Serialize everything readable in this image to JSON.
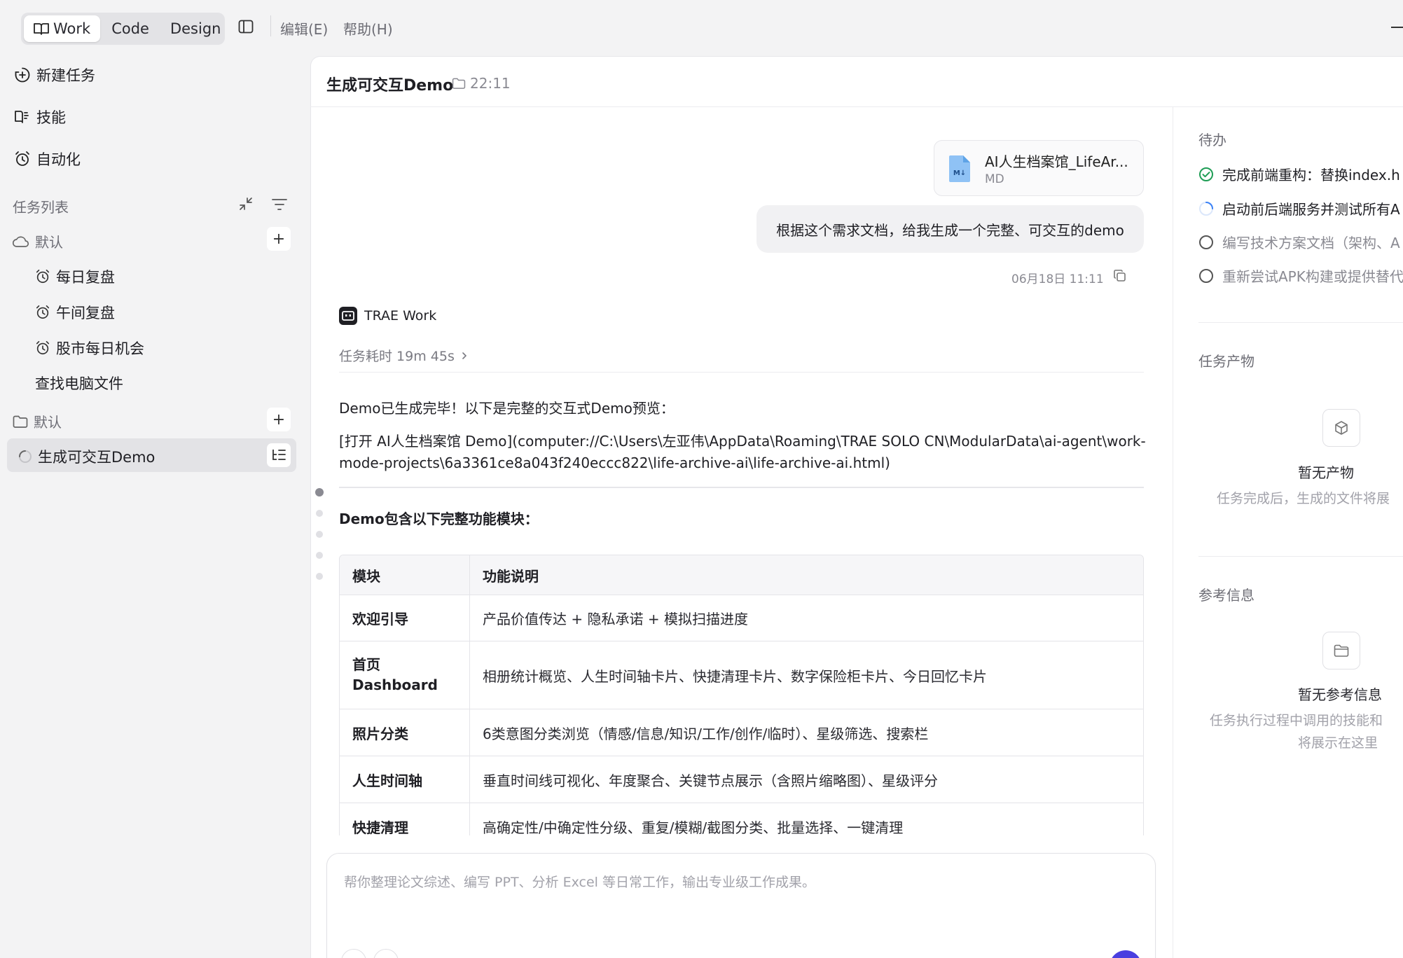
{
  "topbar": {
    "modes": [
      "Work",
      "Code",
      "Design"
    ],
    "active_mode": "Work",
    "menu": [
      "编辑(E)",
      "帮助(H)"
    ]
  },
  "sidebar": {
    "new_task": "新建任务",
    "skills": "技能",
    "automation": "自动化",
    "task_list_title": "任务列表",
    "group1": {
      "name": "默认",
      "items": [
        "每日复盘",
        "午间复盘",
        "股市每日机会",
        "查找电脑文件"
      ]
    },
    "group2": {
      "name": "默认",
      "items": [
        "生成可交互Demo"
      ]
    }
  },
  "header": {
    "title": "生成可交互Demo",
    "time": "22:11"
  },
  "chat": {
    "attachment": {
      "name": "AI人生档案馆_LifeAr...",
      "type": "MD"
    },
    "user_message": "根据这个需求文档，给我生成一个完整、可交互的demo",
    "timestamp": "06月18日 11:11",
    "agent_name": "TRAE Work",
    "duration": "任务耗时 19m 45s",
    "reply_intro": "Demo已生成完毕！以下是完整的交互式Demo预览：",
    "reply_link_line1": "[打开 AI人生档案馆 Demo](computer://C:\\Users\\左亚伟\\AppData\\Roaming\\TRAE SOLO CN\\ModularData\\ai-agent\\work-",
    "reply_link_line2": "mode-projects\\6a3361ce8a043f240eccc822\\life-archive-ai\\life-archive-ai.html)",
    "modules_heading": "Demo包含以下完整功能模块：",
    "table": {
      "headers": [
        "模块",
        "功能说明"
      ],
      "rows": [
        {
          "module": "欢迎引导",
          "desc": "产品价值传达 + 隐私承诺 + 模拟扫描进度"
        },
        {
          "module": "首页 Dashboard",
          "desc": "相册统计概览、人生时间轴卡片、快捷清理卡片、数字保险柜卡片、今日回忆卡片"
        },
        {
          "module": "照片分类",
          "desc": "6类意图分类浏览（情感/信息/知识/工作/创作/临时）、星级筛选、搜索栏"
        },
        {
          "module": "人生时间轴",
          "desc": "垂直时间线可视化、年度聚合、关键节点展示（含照片缩略图）、星级评分"
        },
        {
          "module": "快捷清理",
          "desc": "高确定性/中确定性分级、重复/模糊/截图分类、批量选择、一键清理"
        }
      ]
    },
    "input_placeholder": "帮你整理论文综述、编写 PPT、分析 Excel 等日常工作，输出专业级工作成果。"
  },
  "right_panel": {
    "todo_title": "待办",
    "todos": [
      {
        "text": "完成前端重构：替换index.h",
        "status": "done"
      },
      {
        "text": "启动前后端服务并测试所有A",
        "status": "in-progress"
      },
      {
        "text": "编写技术方案文档（架构、A",
        "status": "pending"
      },
      {
        "text": "重新尝试APK构建或提供替代",
        "status": "pending"
      }
    ],
    "artifacts_title": "任务产物",
    "artifacts_empty_title": "暂无产物",
    "artifacts_empty_desc": "任务完成后，生成的文件将展",
    "refs_title": "参考信息",
    "refs_empty_title": "暂无参考信息",
    "refs_empty_desc_line1": "任务执行过程中调用的技能和",
    "refs_empty_desc_line2": "将展示在这里"
  },
  "colors": {
    "accent": "#4a3fe0",
    "done_green": "#1f9d55",
    "progress_blue": "#3b82f6"
  }
}
